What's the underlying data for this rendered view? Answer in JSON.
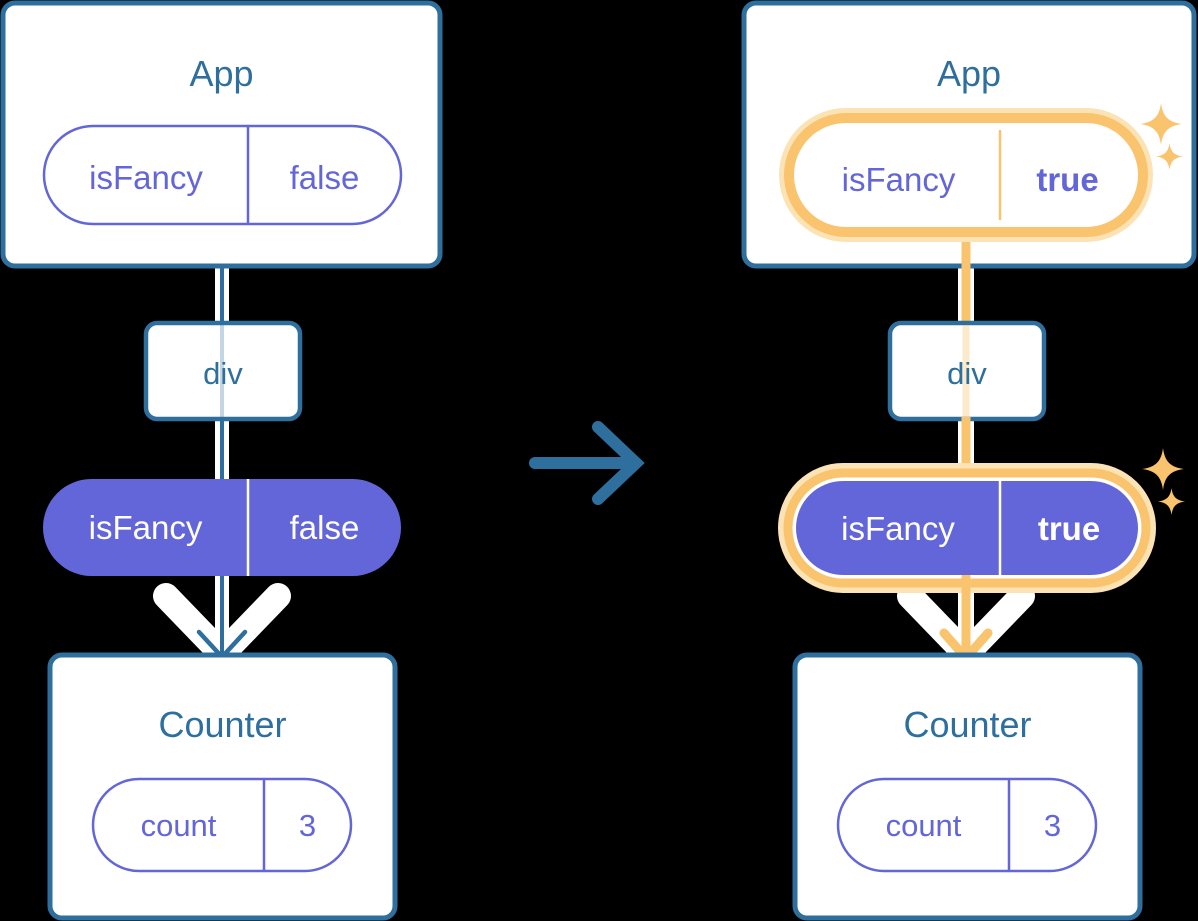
{
  "diagram": {
    "type": "react-state-propagation",
    "description": "Two side-by-side React component trees showing isFancy state changing from false to true",
    "colors": {
      "box_border": "#2e6f9e",
      "box_fill": "#ffffff",
      "title_text": "#2e6f9e",
      "pill_outline_stroke": "#6366d8",
      "pill_outline_text": "#6366d8",
      "pill_solid_fill": "#6366d8",
      "pill_solid_text": "#ffffff",
      "highlight": "#f9c46d",
      "highlight_glow": "#fce3b6",
      "halo": "#ffffff",
      "arrow_connector": "#2e6f9e",
      "background": "#000000"
    },
    "transition_arrow": {
      "icon": "arrow-right-icon",
      "color": "#2e6f9e"
    },
    "panels": [
      {
        "id": "before",
        "highlighted": false,
        "root": {
          "title": "App",
          "pill": {
            "name": "isFancy",
            "value": "false",
            "style": "outline",
            "highlighted": false
          }
        },
        "middle": {
          "title": "div"
        },
        "prop_pill": {
          "name": "isFancy",
          "value": "false",
          "style": "solid",
          "highlighted": false
        },
        "leaf": {
          "title": "Counter",
          "pill": {
            "name": "count",
            "value": "3",
            "style": "outline",
            "highlighted": false
          }
        },
        "sparkles": []
      },
      {
        "id": "after",
        "highlighted": true,
        "root": {
          "title": "App",
          "pill": {
            "name": "isFancy",
            "value": "true",
            "style": "outline",
            "highlighted": true
          }
        },
        "middle": {
          "title": "div"
        },
        "prop_pill": {
          "name": "isFancy",
          "value": "true",
          "style": "solid",
          "highlighted": true
        },
        "leaf": {
          "title": "Counter",
          "pill": {
            "name": "count",
            "value": "3",
            "style": "outline",
            "highlighted": false
          }
        },
        "sparkles": [
          {
            "icon": "sparkle-icon",
            "size": "large"
          },
          {
            "icon": "sparkle-icon",
            "size": "small"
          },
          {
            "icon": "sparkle-icon",
            "size": "large"
          },
          {
            "icon": "sparkle-icon",
            "size": "small"
          }
        ]
      }
    ]
  }
}
